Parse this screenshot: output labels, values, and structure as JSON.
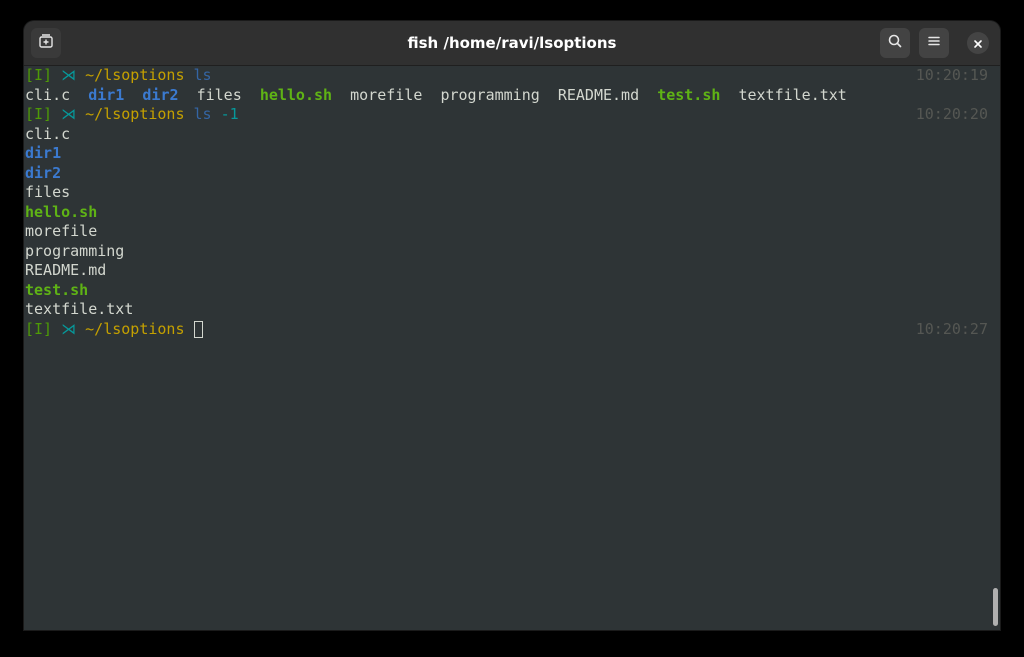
{
  "window": {
    "title": "fish /home/ravi/lsoptions"
  },
  "icons": {
    "new_tab": "new-tab-icon",
    "search": "search-icon",
    "menu": "hamburger-menu-icon",
    "close": "close-icon"
  },
  "colors": {
    "background": "#2e3436",
    "headerbar": "#303030",
    "prompt_bracket": "#4e9a06",
    "prompt_symbol": "#06989a",
    "prompt_path": "#c4a000",
    "command": "#3465a4",
    "directory": "#3b7ad0",
    "executable": "#5fb315",
    "text": "#d3d7cf",
    "timestamp": "#555753"
  },
  "prompt": {
    "mode": "[I]",
    "symbol": "⋊",
    "path": "~/lsoptions"
  },
  "commands": [
    {
      "cmd": "ls",
      "arg": "",
      "time": "10:20:19"
    },
    {
      "cmd": "ls",
      "arg": "-1",
      "time": "10:20:20"
    },
    {
      "cmd": "",
      "arg": "",
      "time": "10:20:27"
    }
  ],
  "listing": [
    {
      "name": "cli.c",
      "type": "file"
    },
    {
      "name": "dir1",
      "type": "directory"
    },
    {
      "name": "dir2",
      "type": "directory"
    },
    {
      "name": "files",
      "type": "file"
    },
    {
      "name": "hello.sh",
      "type": "executable"
    },
    {
      "name": "morefile",
      "type": "file"
    },
    {
      "name": "programming",
      "type": "file"
    },
    {
      "name": "README.md",
      "type": "file"
    },
    {
      "name": "test.sh",
      "type": "executable"
    },
    {
      "name": "textfile.txt",
      "type": "file"
    }
  ]
}
